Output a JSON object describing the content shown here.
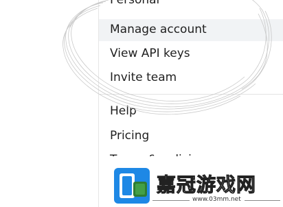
{
  "menu": {
    "items_top": [
      {
        "label": "Personal"
      },
      {
        "label": "Manage account"
      },
      {
        "label": "View API keys"
      },
      {
        "label": "Invite team"
      }
    ],
    "items_bottom": [
      {
        "label": "Help"
      },
      {
        "label": "Pricing"
      },
      {
        "label": "Terms & policies"
      }
    ]
  },
  "watermark": {
    "title": "嘉冠游戏网",
    "url": "www.03mm.net"
  }
}
